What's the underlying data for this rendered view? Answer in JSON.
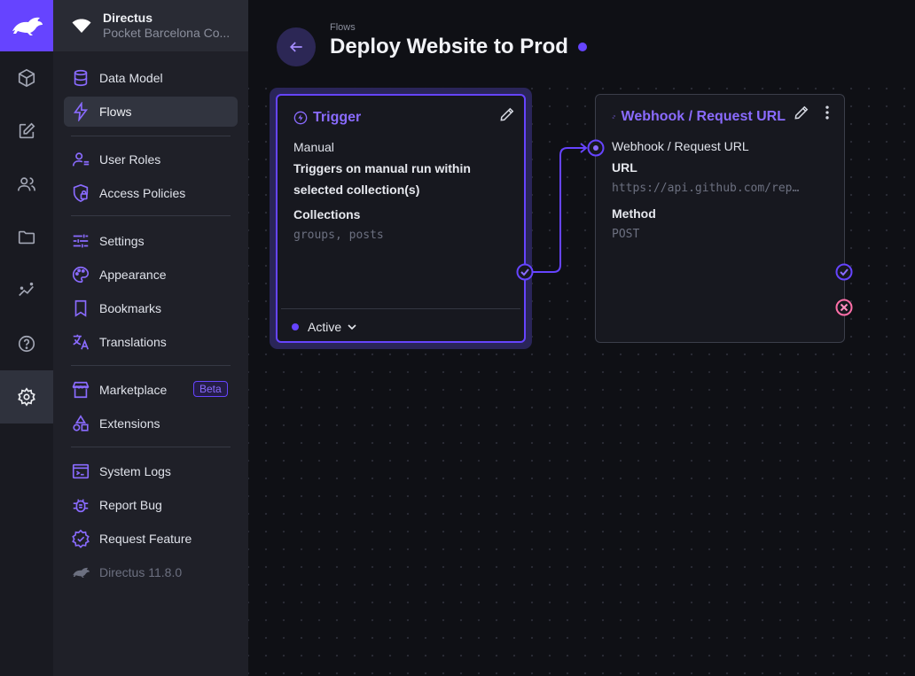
{
  "app": {
    "colors": {
      "accent": "#6644ff",
      "rail_bg": "#191a21",
      "nav_bg": "#1f2028",
      "canvas_bg": "#0f1015",
      "reject": "#ff6fa8"
    }
  },
  "rail": {
    "items": [
      {
        "icon": "cube-icon",
        "name": "content"
      },
      {
        "icon": "edit-icon",
        "name": "visual-editor"
      },
      {
        "icon": "users-icon",
        "name": "user-directory"
      },
      {
        "icon": "folder-icon",
        "name": "files"
      },
      {
        "icon": "insights-icon",
        "name": "insights"
      },
      {
        "icon": "help-icon",
        "name": "help"
      },
      {
        "icon": "gear-icon",
        "name": "settings"
      }
    ]
  },
  "project": {
    "name": "Directus",
    "subtitle": "Pocket Barcelona Co..."
  },
  "nav": {
    "data_model": "Data Model",
    "flows": "Flows",
    "user_roles": "User Roles",
    "access_policies": "Access Policies",
    "settings": "Settings",
    "appearance": "Appearance",
    "bookmarks": "Bookmarks",
    "translations": "Translations",
    "marketplace": "Marketplace",
    "marketplace_badge": "Beta",
    "extensions": "Extensions",
    "system_logs": "System Logs",
    "report_bug": "Report Bug",
    "request_feature": "Request Feature",
    "version": "Directus 11.8.0"
  },
  "header": {
    "breadcrumb": "Flows",
    "title": "Deploy Website to Prod"
  },
  "trigger": {
    "title": "Trigger",
    "type": "Manual",
    "description_line1": "Triggers on manual run within",
    "description_line2": "selected collection(s)",
    "collections_label": "Collections",
    "collections_value": "groups, posts",
    "status": "Active"
  },
  "operation": {
    "title": "Webhook / Request URL",
    "subtitle": "Webhook / Request URL",
    "url_label": "URL",
    "url_value": "https://api.github.com/rep…",
    "method_label": "Method",
    "method_value": "POST"
  }
}
